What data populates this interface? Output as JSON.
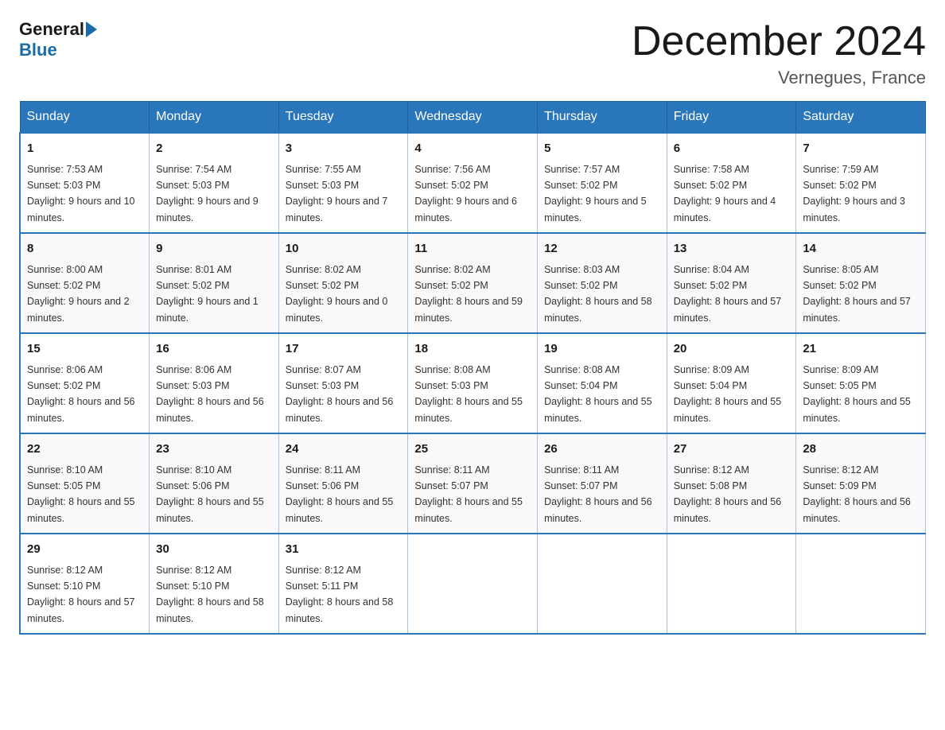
{
  "header": {
    "logo_general": "General",
    "logo_blue": "Blue",
    "month_title": "December 2024",
    "location": "Vernegues, France"
  },
  "days_of_week": [
    "Sunday",
    "Monday",
    "Tuesday",
    "Wednesday",
    "Thursday",
    "Friday",
    "Saturday"
  ],
  "weeks": [
    [
      {
        "num": "1",
        "sunrise": "7:53 AM",
        "sunset": "5:03 PM",
        "daylight": "9 hours and 10 minutes."
      },
      {
        "num": "2",
        "sunrise": "7:54 AM",
        "sunset": "5:03 PM",
        "daylight": "9 hours and 9 minutes."
      },
      {
        "num": "3",
        "sunrise": "7:55 AM",
        "sunset": "5:03 PM",
        "daylight": "9 hours and 7 minutes."
      },
      {
        "num": "4",
        "sunrise": "7:56 AM",
        "sunset": "5:02 PM",
        "daylight": "9 hours and 6 minutes."
      },
      {
        "num": "5",
        "sunrise": "7:57 AM",
        "sunset": "5:02 PM",
        "daylight": "9 hours and 5 minutes."
      },
      {
        "num": "6",
        "sunrise": "7:58 AM",
        "sunset": "5:02 PM",
        "daylight": "9 hours and 4 minutes."
      },
      {
        "num": "7",
        "sunrise": "7:59 AM",
        "sunset": "5:02 PM",
        "daylight": "9 hours and 3 minutes."
      }
    ],
    [
      {
        "num": "8",
        "sunrise": "8:00 AM",
        "sunset": "5:02 PM",
        "daylight": "9 hours and 2 minutes."
      },
      {
        "num": "9",
        "sunrise": "8:01 AM",
        "sunset": "5:02 PM",
        "daylight": "9 hours and 1 minute."
      },
      {
        "num": "10",
        "sunrise": "8:02 AM",
        "sunset": "5:02 PM",
        "daylight": "9 hours and 0 minutes."
      },
      {
        "num": "11",
        "sunrise": "8:02 AM",
        "sunset": "5:02 PM",
        "daylight": "8 hours and 59 minutes."
      },
      {
        "num": "12",
        "sunrise": "8:03 AM",
        "sunset": "5:02 PM",
        "daylight": "8 hours and 58 minutes."
      },
      {
        "num": "13",
        "sunrise": "8:04 AM",
        "sunset": "5:02 PM",
        "daylight": "8 hours and 57 minutes."
      },
      {
        "num": "14",
        "sunrise": "8:05 AM",
        "sunset": "5:02 PM",
        "daylight": "8 hours and 57 minutes."
      }
    ],
    [
      {
        "num": "15",
        "sunrise": "8:06 AM",
        "sunset": "5:02 PM",
        "daylight": "8 hours and 56 minutes."
      },
      {
        "num": "16",
        "sunrise": "8:06 AM",
        "sunset": "5:03 PM",
        "daylight": "8 hours and 56 minutes."
      },
      {
        "num": "17",
        "sunrise": "8:07 AM",
        "sunset": "5:03 PM",
        "daylight": "8 hours and 56 minutes."
      },
      {
        "num": "18",
        "sunrise": "8:08 AM",
        "sunset": "5:03 PM",
        "daylight": "8 hours and 55 minutes."
      },
      {
        "num": "19",
        "sunrise": "8:08 AM",
        "sunset": "5:04 PM",
        "daylight": "8 hours and 55 minutes."
      },
      {
        "num": "20",
        "sunrise": "8:09 AM",
        "sunset": "5:04 PM",
        "daylight": "8 hours and 55 minutes."
      },
      {
        "num": "21",
        "sunrise": "8:09 AM",
        "sunset": "5:05 PM",
        "daylight": "8 hours and 55 minutes."
      }
    ],
    [
      {
        "num": "22",
        "sunrise": "8:10 AM",
        "sunset": "5:05 PM",
        "daylight": "8 hours and 55 minutes."
      },
      {
        "num": "23",
        "sunrise": "8:10 AM",
        "sunset": "5:06 PM",
        "daylight": "8 hours and 55 minutes."
      },
      {
        "num": "24",
        "sunrise": "8:11 AM",
        "sunset": "5:06 PM",
        "daylight": "8 hours and 55 minutes."
      },
      {
        "num": "25",
        "sunrise": "8:11 AM",
        "sunset": "5:07 PM",
        "daylight": "8 hours and 55 minutes."
      },
      {
        "num": "26",
        "sunrise": "8:11 AM",
        "sunset": "5:07 PM",
        "daylight": "8 hours and 56 minutes."
      },
      {
        "num": "27",
        "sunrise": "8:12 AM",
        "sunset": "5:08 PM",
        "daylight": "8 hours and 56 minutes."
      },
      {
        "num": "28",
        "sunrise": "8:12 AM",
        "sunset": "5:09 PM",
        "daylight": "8 hours and 56 minutes."
      }
    ],
    [
      {
        "num": "29",
        "sunrise": "8:12 AM",
        "sunset": "5:10 PM",
        "daylight": "8 hours and 57 minutes."
      },
      {
        "num": "30",
        "sunrise": "8:12 AM",
        "sunset": "5:10 PM",
        "daylight": "8 hours and 58 minutes."
      },
      {
        "num": "31",
        "sunrise": "8:12 AM",
        "sunset": "5:11 PM",
        "daylight": "8 hours and 58 minutes."
      },
      null,
      null,
      null,
      null
    ]
  ]
}
